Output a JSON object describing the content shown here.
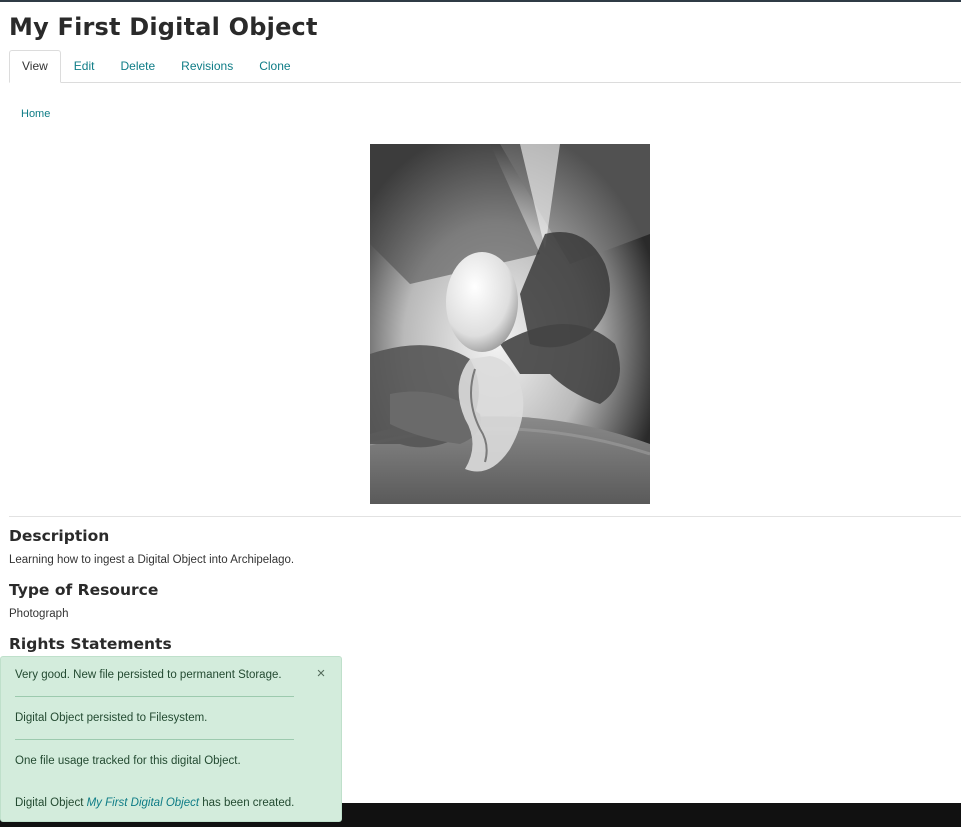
{
  "page": {
    "title": "My First Digital Object"
  },
  "tabs": [
    {
      "label": "View",
      "active": true
    },
    {
      "label": "Edit"
    },
    {
      "label": "Delete"
    },
    {
      "label": "Revisions"
    },
    {
      "label": "Clone"
    }
  ],
  "breadcrumb": {
    "home": "Home"
  },
  "fields": {
    "description": {
      "label": "Description",
      "value": "Learning how to ingest a Digital Object into Archipelago."
    },
    "type_of_resource": {
      "label": "Type of Resource",
      "value": "Photograph"
    },
    "rights": {
      "label": "Rights Statements"
    }
  },
  "messages": {
    "close": "×",
    "items": [
      "Very good. New file persisted to permanent Storage.",
      "Digital Object persisted to Filesystem.",
      "One file usage tracked for this digital Object."
    ],
    "created_prefix": "Digital Object",
    "created_link": "My First Digital Object",
    "created_suffix": "has been created."
  },
  "colors": {
    "link": "#0e7c86",
    "message_bg": "#d3ecdc",
    "message_text": "#234a31"
  }
}
